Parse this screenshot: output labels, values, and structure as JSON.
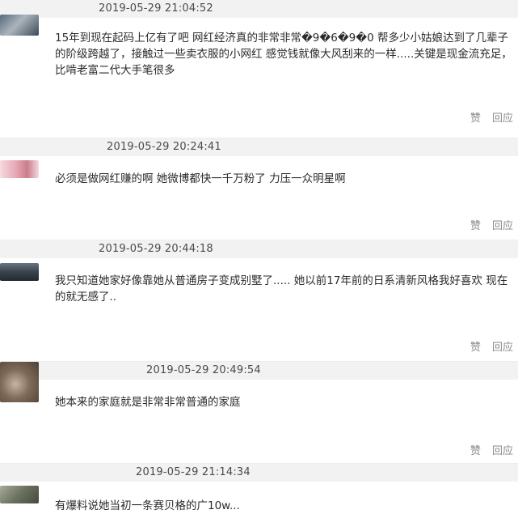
{
  "comments": [
    {
      "timestamp": "2019-05-29 21:04:52",
      "text": "15年到现在起码上亿有了吧  网红经济真的非常非常�9�6�9�0 帮多少小姑娘达到了几辈子的阶级跨越了，接触过一些卖衣服的小网红  感觉钱就像大风刮来的一样.....关键是现金流充足，比啃老富二代大手笔很多",
      "avatar_colors": [
        "#5a6a7a",
        "#aab4bc",
        "#3c4a56"
      ]
    },
    {
      "timestamp": "2019-05-29 20:24:41",
      "text": "必须是做网红赚的啊  她微博都快一千万粉了  力压一众明星啊",
      "avatar_colors": [
        "#e7a9b5",
        "#f6d9de",
        "#c97d8c"
      ]
    },
    {
      "timestamp": "2019-05-29 20:44:18",
      "text": "我只知道她家好像靠她从普通房子变成别墅了.....  她以前17年前的日系清新风格我好喜欢  现在的就无感了..",
      "avatar_colors": [
        "#39434d",
        "#687580",
        "#222a31"
      ]
    },
    {
      "timestamp": "2019-05-29 20:49:54",
      "text": "她本来的家庭就是非常非常普通的家庭",
      "avatar_colors": [
        "#7e6a58",
        "#c7b6a4",
        "#4f4136"
      ]
    },
    {
      "timestamp": "2019-05-29 21:14:34",
      "text": "有爆料说她当初一条赛贝格的广10w...",
      "avatar_colors": [
        "#6b7160",
        "#a9ac99",
        "#45493e"
      ]
    }
  ],
  "actions": {
    "like_label": "赞",
    "reply_label": "回应"
  }
}
